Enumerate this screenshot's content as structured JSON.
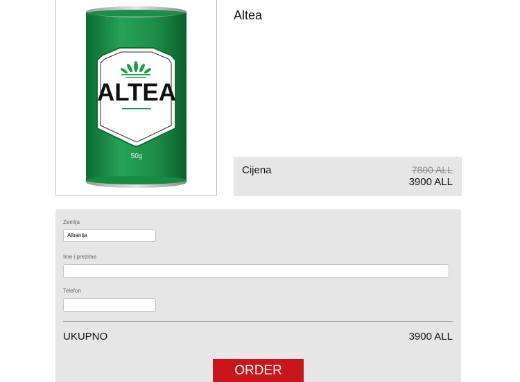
{
  "product": {
    "title": "Altea",
    "image": {
      "brand_text": "ALTEA",
      "weight_text": "50g",
      "can_color": "#1f8f4a",
      "label_color": "#ffffff"
    }
  },
  "price": {
    "label": "Cijena",
    "old_price": "7800 ALL",
    "new_price": "3900 ALL"
  },
  "form": {
    "country": {
      "label": "Zemlja",
      "value": "Albanija"
    },
    "name": {
      "label": "Ime i prezime",
      "value": ""
    },
    "phone": {
      "label": "Telefon",
      "value": ""
    },
    "total": {
      "label": "UKUPNO",
      "value": "3900 ALL"
    },
    "submit_label": "ORDER"
  },
  "colors": {
    "accent": "#c9151c",
    "panel": "#e6e6e6"
  }
}
